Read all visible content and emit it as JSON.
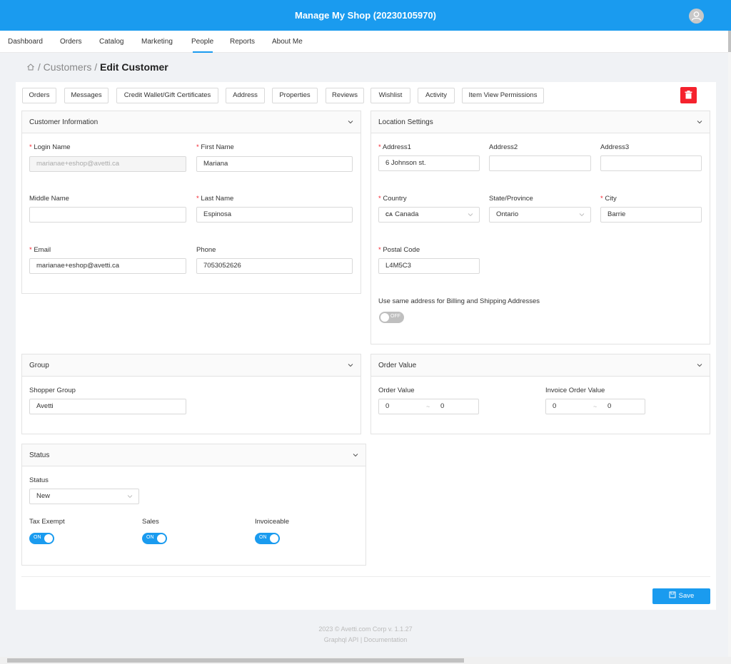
{
  "header": {
    "title": "Manage My Shop (20230105970)"
  },
  "nav": {
    "items": [
      "Dashboard",
      "Orders",
      "Catalog",
      "Marketing",
      "People",
      "Reports",
      "About Me"
    ],
    "active": "People"
  },
  "breadcrumb": {
    "sep": "/",
    "parent": "Customers",
    "current": "Edit Customer"
  },
  "tabs": [
    "Orders",
    "Messages",
    "Credit Wallet/Gift Certificates",
    "Address",
    "Properties",
    "Reviews",
    "Wishlist",
    "Activity",
    "Item View Permissions"
  ],
  "customer_info": {
    "title": "Customer Information",
    "login_label": "Login Name",
    "login_value": "marianae+eshop@avetti.ca",
    "first_label": "First Name",
    "first_value": "Mariana",
    "middle_label": "Middle Name",
    "middle_value": "",
    "last_label": "Last Name",
    "last_value": "Espinosa",
    "email_label": "Email",
    "email_value": "marianae+eshop@avetti.ca",
    "phone_label": "Phone",
    "phone_value": "7053052626"
  },
  "location": {
    "title": "Location Settings",
    "address1_label": "Address1",
    "address1_value": "6 Johnson st.",
    "address2_label": "Address2",
    "address2_value": "",
    "address3_label": "Address3",
    "address3_value": "",
    "country_label": "Country",
    "country_flag": "CA",
    "country_value": "Canada",
    "state_label": "State/Province",
    "state_value": "Ontario",
    "city_label": "City",
    "city_value": "Barrie",
    "postal_label": "Postal Code",
    "postal_value": "L4M5C3",
    "same_address_label": "Use same address for Billing and Shipping Addresses",
    "same_address_toggle": "OFF"
  },
  "group": {
    "title": "Group",
    "shopper_label": "Shopper Group",
    "shopper_value": "Avetti"
  },
  "order_value": {
    "title": "Order Value",
    "order_label": "Order Value",
    "order_min": "0",
    "order_max": "0",
    "invoice_label": "Invoice Order Value",
    "invoice_min": "0",
    "invoice_max": "0",
    "range_sep": "~"
  },
  "status": {
    "title": "Status",
    "status_label": "Status",
    "status_value": "New",
    "tax_label": "Tax Exempt",
    "tax_toggle": "ON",
    "sales_label": "Sales",
    "sales_toggle": "ON",
    "invoice_label": "Invoiceable",
    "invoice_toggle": "ON"
  },
  "actions": {
    "save_label": "Save"
  },
  "footer": {
    "line1": "2023 © Avetti.com Corp v. 1.1.27",
    "api_link": "Graphql API",
    "link_sep": "|",
    "docs_link": "Documentation"
  },
  "colors": {
    "primary": "#1a9bef",
    "danger": "#f5222d"
  }
}
